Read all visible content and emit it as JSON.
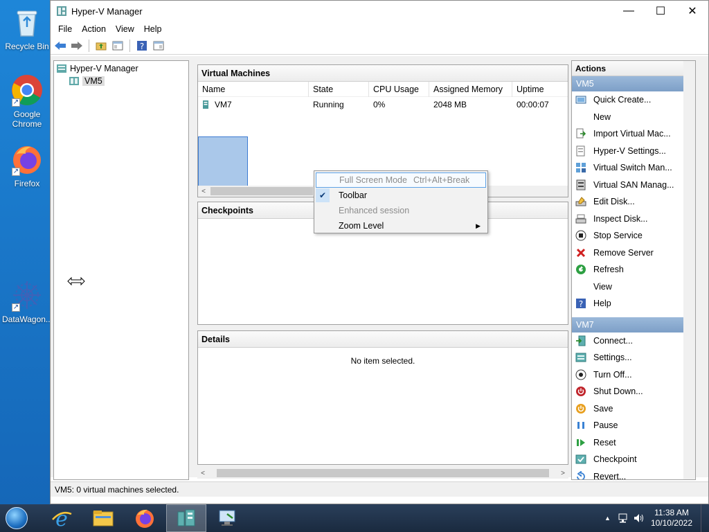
{
  "desktop": {
    "icons": [
      {
        "label": "Recycle Bin",
        "icon": "recycle-bin-icon"
      },
      {
        "label": "Google Chrome",
        "icon": "chrome-icon"
      },
      {
        "label": "Firefox",
        "icon": "firefox-icon"
      },
      {
        "label": "DataWagon...",
        "icon": "datawagon-icon"
      }
    ]
  },
  "window": {
    "title": "Hyper-V Manager",
    "controls": {
      "minimize": "—",
      "maximize": "☐",
      "close": "✕"
    },
    "menu": [
      "File",
      "Action",
      "View",
      "Help"
    ],
    "toolbar_icons": [
      "back-icon",
      "forward-icon",
      "up-folder-icon",
      "show-hide-tree-icon",
      "help-icon",
      "console-tree-icon"
    ]
  },
  "tree": {
    "root": "Hyper-V Manager",
    "child": "VM5"
  },
  "vm_panel": {
    "title": "Virtual Machines",
    "columns": [
      "Name",
      "State",
      "CPU Usage",
      "Assigned Memory",
      "Uptime"
    ],
    "rows": [
      {
        "name": "VM7",
        "state": "Running",
        "cpu": "0%",
        "memory": "2048 MB",
        "uptime": "00:00:07"
      }
    ]
  },
  "checkpoints": {
    "title": "Checkpoints"
  },
  "details": {
    "title": "Details",
    "empty_text": "No item selected."
  },
  "actions": {
    "title": "Actions",
    "groups": [
      {
        "name": "VM5",
        "items": [
          {
            "label": "Quick Create...",
            "icon": "quick-create-icon"
          },
          {
            "label": "New",
            "icon": "",
            "submenu": "▶"
          },
          {
            "label": "Import Virtual Mac...",
            "icon": "import-icon"
          },
          {
            "label": "Hyper-V Settings...",
            "icon": "settings-icon"
          },
          {
            "label": "Virtual Switch Man...",
            "icon": "switch-icon"
          },
          {
            "label": "Virtual SAN Manag...",
            "icon": "san-icon"
          },
          {
            "label": "Edit Disk...",
            "icon": "edit-disk-icon"
          },
          {
            "label": "Inspect Disk...",
            "icon": "inspect-disk-icon"
          },
          {
            "label": "Stop Service",
            "icon": "stop-icon"
          },
          {
            "label": "Remove Server",
            "icon": "remove-icon"
          },
          {
            "label": "Refresh",
            "icon": "refresh-icon"
          },
          {
            "label": "View",
            "icon": "",
            "submenu": "▶"
          },
          {
            "label": "Help",
            "icon": "help-icon"
          }
        ]
      },
      {
        "name": "VM7",
        "items": [
          {
            "label": "Connect...",
            "icon": "connect-icon"
          },
          {
            "label": "Settings...",
            "icon": "vm-settings-icon"
          },
          {
            "label": "Turn Off...",
            "icon": "turn-off-icon"
          },
          {
            "label": "Shut Down...",
            "icon": "shut-down-icon"
          },
          {
            "label": "Save",
            "icon": "save-icon"
          },
          {
            "label": "Pause",
            "icon": "pause-icon"
          },
          {
            "label": "Reset",
            "icon": "reset-icon"
          },
          {
            "label": "Checkpoint",
            "icon": "checkpoint-icon"
          },
          {
            "label": "Revert...",
            "icon": "revert-icon"
          }
        ]
      }
    ]
  },
  "context_menu": {
    "items": [
      {
        "label": "Full Screen Mode",
        "shortcut": "Ctrl+Alt+Break",
        "disabled": true,
        "highlighted": true
      },
      {
        "label": "Toolbar",
        "checked": true
      },
      {
        "label": "Enhanced session",
        "disabled": true
      },
      {
        "label": "Zoom Level",
        "submenu": "▶"
      }
    ]
  },
  "status": {
    "text": "VM5:  0 virtual machines selected."
  },
  "taskbar": {
    "apps": [
      "ie-icon",
      "file-explorer-icon",
      "firefox-icon",
      "hyperv-manager-icon",
      "vm-connect-icon"
    ],
    "clock_time": "11:38 AM",
    "clock_date": "10/10/2022",
    "tray_icons": [
      "show-hidden-icon",
      "network-icon",
      "volume-icon"
    ],
    "tray_chevron": "▲"
  },
  "colors": {
    "selection": "#aac8ea",
    "action_group": "#8aaad0",
    "accent": "#1e86d8"
  }
}
